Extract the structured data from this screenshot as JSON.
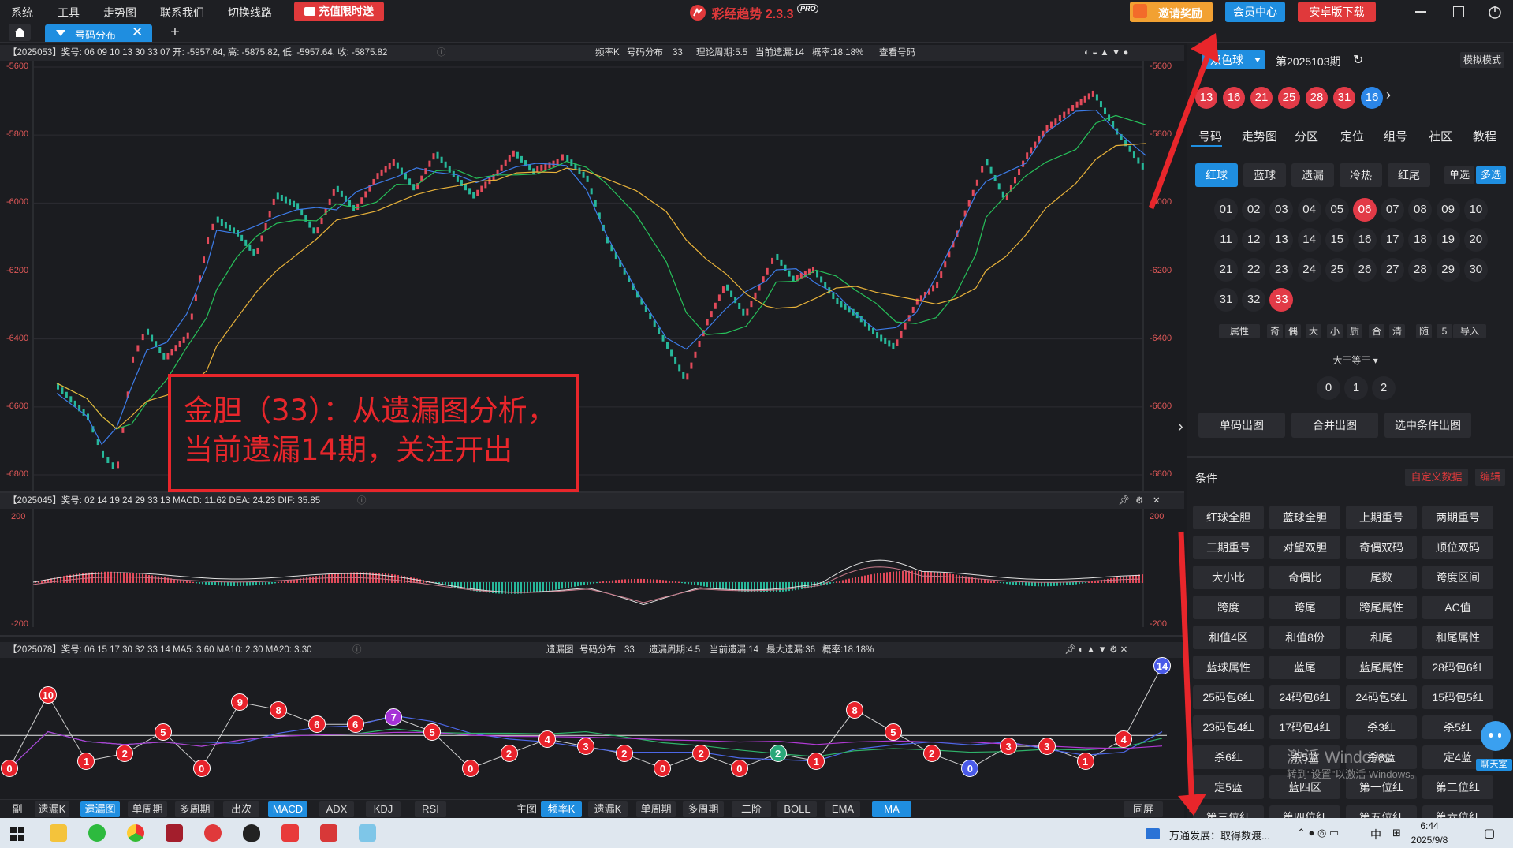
{
  "menubar": {
    "items": [
      "系统",
      "工具",
      "走势图",
      "联系我们",
      "切换线路"
    ],
    "promo_label": "充值限时送",
    "app_title": "彩经趋势 2.3.3",
    "pro_badge": "PRO",
    "invite_label": "邀请奖励",
    "member_label": "会员中心",
    "android_label": "安卓版下载"
  },
  "tabs": {
    "active_label": "号码分布",
    "plus": "+"
  },
  "main_chart": {
    "header_left": "【2025053】奖号: 06 09 10 13 30 33 07  开: -5957.64, 高: -5875.82, 低: -5957.64, 收: -5875.82",
    "header_right": [
      "频率K",
      "号码分布",
      "33",
      "理论周期:5.5",
      "当前遗漏:14",
      "概率:18.18%",
      "查看号码"
    ],
    "y_labels": [
      "-5600",
      "-5800",
      "-6000",
      "-6200",
      "-6400",
      "-6600",
      "-6800"
    ],
    "ylim": [
      -6800,
      -5600
    ]
  },
  "macd_chart": {
    "header": "【2025045】奖号: 02 14 19 24 29 33 13  MACD: 11.62  DEA: 24.23  DIF: 35.85",
    "y_labels": [
      "200",
      "-200"
    ]
  },
  "miss_chart": {
    "header_left": "【2025078】奖号: 06 15 17 30 32 33 14  MA5: 3.60  MA10: 2.30  MA20: 3.30",
    "header_right": [
      "遗漏图",
      "号码分布",
      "33",
      "遗漏周期:4.5",
      "当前遗漏:14",
      "最大遗漏:36",
      "概率:18.18%"
    ],
    "values": [
      0,
      10,
      1,
      2,
      5,
      0,
      9,
      8,
      6,
      6,
      7,
      5,
      0,
      2,
      4,
      3,
      2,
      0,
      2,
      0,
      2,
      1,
      8,
      5,
      2,
      0,
      3,
      3,
      1,
      4,
      14
    ]
  },
  "annotation": {
    "line1": "金胆（33）：从遗漏图分析，",
    "line2": "当前遗漏14期，关注开出"
  },
  "bottom_left": [
    "副图",
    "遗漏K",
    "遗漏图",
    "单周期",
    "多周期",
    "出次",
    "MACD",
    "ADX",
    "KDJ",
    "RSI"
  ],
  "bottom_right": [
    "主图",
    "频率K",
    "遗漏K",
    "单周期",
    "多周期",
    "二阶",
    "BOLL",
    "EMA",
    "MA"
  ],
  "bottom_same": "同屏",
  "right_panel": {
    "ball_select": "双色球",
    "period": "第2025103期",
    "sim_mode": "模拟模式",
    "red_balls": [
      "13",
      "16",
      "21",
      "25",
      "28",
      "31"
    ],
    "blue_ball": "16",
    "tabs": [
      "号码",
      "走势图",
      "分区",
      "定位",
      "组号",
      "社区",
      "教程"
    ],
    "subtabs": [
      "红球",
      "蓝球",
      "遗漏",
      "冷热",
      "红尾"
    ],
    "single": "单选",
    "multi": "多选",
    "numbers": [
      "01",
      "02",
      "03",
      "04",
      "05",
      "06",
      "07",
      "08",
      "09",
      "10",
      "11",
      "12",
      "13",
      "14",
      "15",
      "16",
      "17",
      "18",
      "19",
      "20",
      "21",
      "22",
      "23",
      "24",
      "25",
      "26",
      "27",
      "28",
      "29",
      "30",
      "31",
      "32",
      "33"
    ],
    "selected": [
      "06",
      "33"
    ],
    "attr_row": [
      "属性",
      "奇",
      "偶",
      "大",
      "小",
      "质",
      "合",
      "清",
      "随",
      "5",
      "导入"
    ],
    "ge_label": "大于等于",
    "ge_options": [
      "0",
      "1",
      "2"
    ],
    "actions": [
      "单码出图",
      "合并出图",
      "选中条件出图"
    ],
    "cond_title": "条件",
    "custom_data": "自定义数据",
    "edit": "编辑",
    "conditions": [
      "红球全胆",
      "蓝球全胆",
      "上期重号",
      "两期重号",
      "三期重号",
      "对望双胆",
      "奇偶双码",
      "顺位双码",
      "大小比",
      "奇偶比",
      "尾数",
      "跨度区间",
      "跨度",
      "跨尾",
      "跨尾属性",
      "AC值",
      "和值4区",
      "和值8份",
      "和尾",
      "和尾属性",
      "蓝球属性",
      "蓝尾",
      "蓝尾属性",
      "28码包6红",
      "25码包6红",
      "24码包6红",
      "24码包5红",
      "15码包5红",
      "23码包4红",
      "17码包4红",
      "杀3红",
      "杀5红",
      "杀6红",
      "杀5蓝",
      "杀8蓝",
      "定4蓝",
      "定5蓝",
      "蓝四区",
      "第一位红",
      "第二位红",
      "第三位红",
      "第四位红",
      "第五位红",
      "第六位红"
    ],
    "chat": "聊天室",
    "watermark1": "激活 Windows",
    "watermark2": "转到\"设置\"以激活 Windows。"
  },
  "taskbar": {
    "news": "万通发展：取得数渡...",
    "ime": "中",
    "time": "6:44",
    "date": "2025/9/8"
  }
}
